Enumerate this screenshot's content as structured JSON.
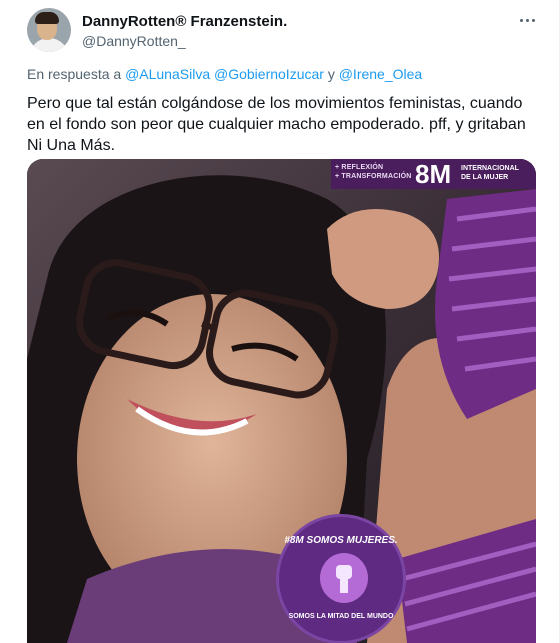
{
  "author": {
    "display_name": "DannyRotten® Franzenstein.",
    "handle": "@DannyRotten_"
  },
  "reply": {
    "prefix": "En respuesta a",
    "mentions": [
      "@ALunaSilva",
      "@GobiernoIzucar",
      "@Irene_Olea"
    ],
    "connector": "y"
  },
  "tweet": {
    "text": "Pero que tal están colgándose de los movimientos feministas, cuando en el fondo son peor que cualquier macho empoderado. pff, y gritaban Ni Una Más."
  },
  "media": {
    "banner_small_1": "+ REFLEXIÓN",
    "banner_small_2": "+ TRANSFORMACIÓN",
    "banner_big": "8M",
    "banner_right_1": "INTERNACIONAL",
    "banner_right_2": "DE LA MUJER",
    "badge_top": "#8M SOMOS MUJERES.",
    "badge_bottom": "SOMOS LA MITAD DEL MUNDO"
  },
  "icons": {
    "more": "more-horizontal-icon"
  }
}
